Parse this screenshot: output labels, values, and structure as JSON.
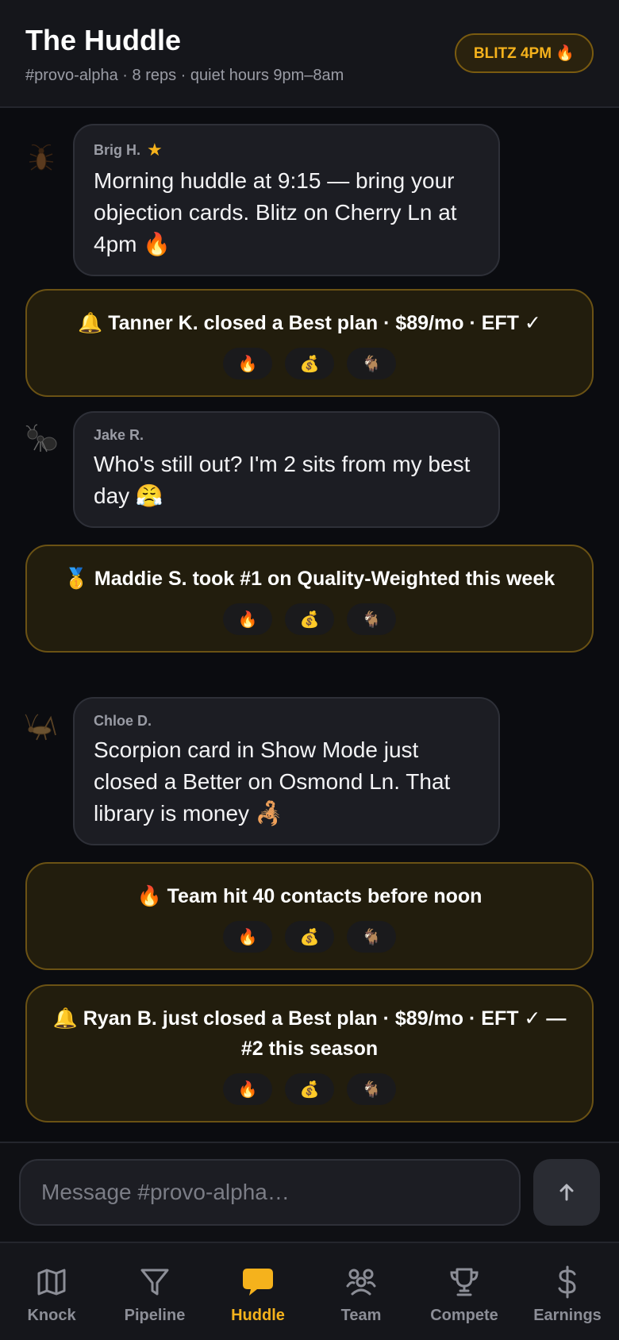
{
  "header": {
    "title": "The Huddle",
    "subtitle": "#provo-alpha · 8 reps · quiet hours 9pm–8am",
    "blitz_badge": "BLITZ 4PM 🔥"
  },
  "colors": {
    "accent": "#f5b21c",
    "event_bg": "#221d0d",
    "event_border": "#6b5214",
    "bubble_bg": "#1c1d23"
  },
  "messages": [
    {
      "author": "Brig H.",
      "star": "★",
      "avatar_icon": "cockroach-icon",
      "text": "Morning huddle at 9:15 — bring your objection cards. Blitz on Cherry Ln at 4pm 🔥"
    },
    {
      "author": "Jake R.",
      "avatar_icon": "ant-icon",
      "text": "Who's still out? I'm 2 sits from my best day 😤"
    },
    {
      "author": "Chloe D.",
      "avatar_icon": "cricket-icon",
      "text": "Scorpion card in Show Mode just closed a Better on Osmond Ln. That library is money 🦂"
    }
  ],
  "events": [
    {
      "text": "🔔 Tanner K. closed a Best plan · $89/mo · EFT ✓",
      "reactions": [
        "🔥",
        "💰",
        "🐐"
      ]
    },
    {
      "text": "🥇 Maddie S. took #1 on Quality-Weighted this week",
      "reactions": [
        "🔥",
        "💰",
        "🐐"
      ]
    },
    {
      "text": "🔥 Team hit 40 contacts before noon",
      "reactions": [
        "🔥",
        "💰",
        "🐐"
      ]
    },
    {
      "text": "🔔 Ryan B. just closed a Best plan · $89/mo · EFT ✓ — #2 this season",
      "reactions": [
        "🔥",
        "💰",
        "🐐"
      ]
    }
  ],
  "composer": {
    "placeholder": "Message #provo-alpha…",
    "send_icon": "arrow-up-icon"
  },
  "tabs": [
    {
      "label": "Knock",
      "icon": "map-icon",
      "active": false
    },
    {
      "label": "Pipeline",
      "icon": "filter-icon",
      "active": false
    },
    {
      "label": "Huddle",
      "icon": "chat-bubble-icon",
      "active": true
    },
    {
      "label": "Team",
      "icon": "team-icon",
      "active": false
    },
    {
      "label": "Compete",
      "icon": "trophy-icon",
      "active": false
    },
    {
      "label": "Earnings",
      "icon": "dollar-icon",
      "active": false
    }
  ]
}
